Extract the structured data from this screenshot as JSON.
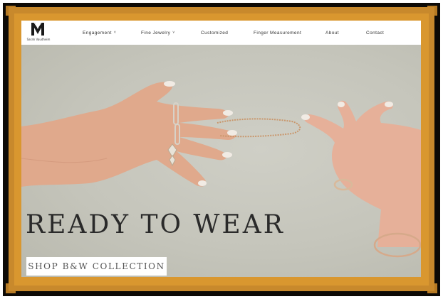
{
  "brand": {
    "name": "Sarah Vaudheim"
  },
  "nav": {
    "items": [
      {
        "label": "Engagement",
        "has_dropdown": true
      },
      {
        "label": "Fine Jewelry",
        "has_dropdown": true
      },
      {
        "label": "Customized",
        "has_dropdown": false
      },
      {
        "label": "Finger Measurement",
        "has_dropdown": false
      },
      {
        "label": "About",
        "has_dropdown": false
      },
      {
        "label": "Contact",
        "has_dropdown": false
      }
    ],
    "dropdown_glyph": "˅"
  },
  "hero": {
    "headline": "READY TO WEAR",
    "cta_label": "SHOP B&W COLLECTION"
  },
  "colors": {
    "frame_gold": "#c8892c",
    "frame_dark": "#0d0a06",
    "hero_bg": "#c9c9c0",
    "text_dark": "#2a2a2a"
  }
}
